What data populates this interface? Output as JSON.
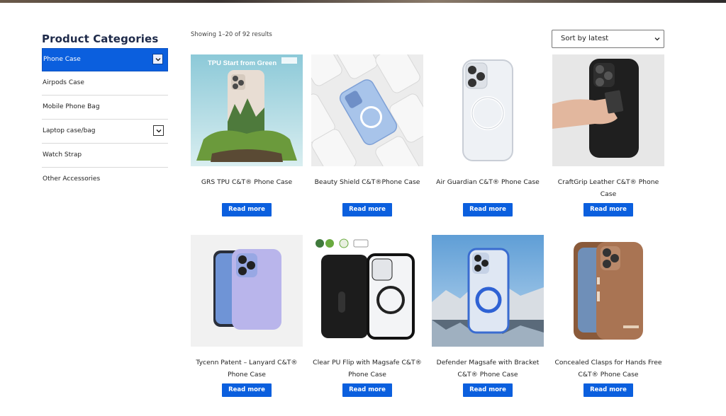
{
  "sidebar": {
    "title": "Product Categories",
    "items": [
      {
        "label": "Phone Case",
        "active": true,
        "has_toggle": true
      },
      {
        "label": "Airpods Case"
      },
      {
        "label": "Mobile Phone Bag"
      },
      {
        "label": "Laptop case/bag",
        "has_toggle": true
      },
      {
        "label": "Watch Strap"
      },
      {
        "label": "Other Accessories"
      }
    ]
  },
  "toolbar": {
    "results_text": "Showing 1–20 of 92 results",
    "sort_selected": "Sort by latest"
  },
  "colors": {
    "accent": "#0b5fde"
  },
  "products": [
    {
      "name": "GRS TPU C&T® Phone Case",
      "image_text": "TPU Start from Green",
      "button": "Read more"
    },
    {
      "name": "Beauty Shield C&T®Phone Case",
      "button": "Read more"
    },
    {
      "name": "Air Guardian C&T® Phone Case",
      "button": "Read more"
    },
    {
      "name": "CraftGrip Leather C&T® Phone Case",
      "button": "Read more"
    },
    {
      "name": "Tycenn Patent – Lanyard C&T® Phone Case",
      "button": "Read more"
    },
    {
      "name": "Clear PU Flip with Magsafe C&T® Phone Case",
      "button": "Read more"
    },
    {
      "name": "Defender Magsafe with Bracket C&T® Phone Case",
      "button": "Read more"
    },
    {
      "name": "Concealed Clasps for Hands Free C&T® Phone Case",
      "button": "Read more"
    }
  ]
}
